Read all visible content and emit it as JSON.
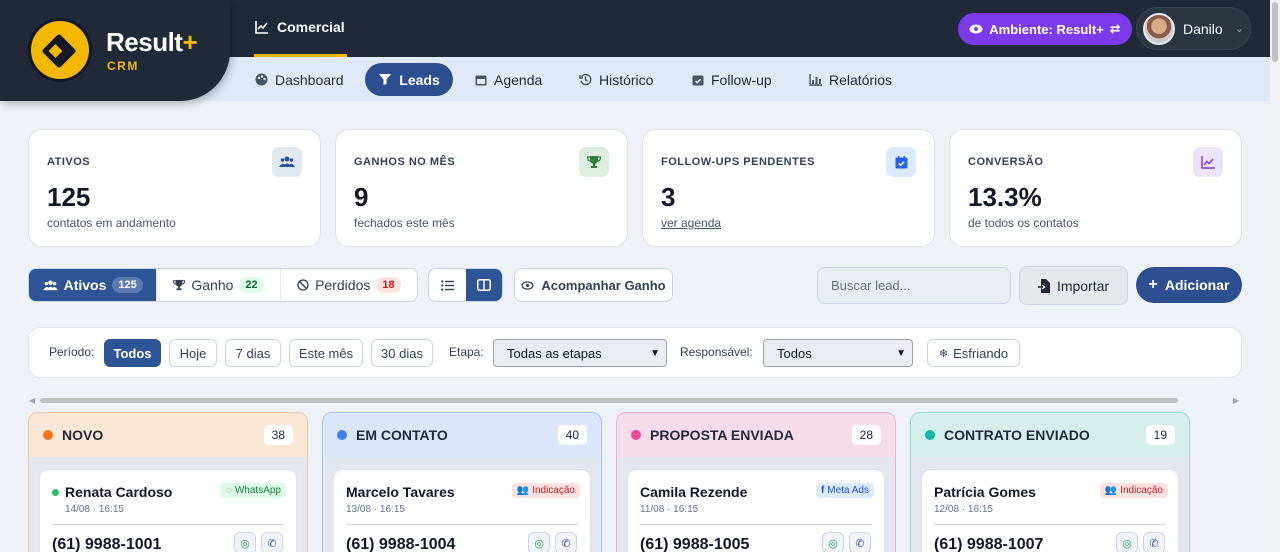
{
  "app": {
    "brand": "Result",
    "brand_plus": "+",
    "brand_sub": "CRM",
    "module": "Comercial"
  },
  "env": {
    "label": "Ambiente: Result+"
  },
  "user": {
    "name": "Danilo"
  },
  "nav": [
    {
      "label": "Dashboard",
      "icon": "palette-icon"
    },
    {
      "label": "Leads",
      "icon": "funnel-icon",
      "active": true
    },
    {
      "label": "Agenda",
      "icon": "calendar-icon"
    },
    {
      "label": "Histórico",
      "icon": "history-icon"
    },
    {
      "label": "Follow-up",
      "icon": "calendar-check-icon"
    },
    {
      "label": "Relatórios",
      "icon": "bar-chart-icon"
    }
  ],
  "stats": [
    {
      "label": "ATIVOS",
      "value": "125",
      "sub": "contatos em andamento",
      "icon": "users-icon",
      "color": "#2d5596"
    },
    {
      "label": "GANHOS NO MÊS",
      "value": "9",
      "sub": "fechados este mês",
      "icon": "trophy-icon",
      "color": "#16a34a"
    },
    {
      "label": "FOLLOW-UPS PENDENTES",
      "value": "3",
      "sub": "ver agenda",
      "icon": "calendar-check-icon",
      "color": "#2563eb"
    },
    {
      "label": "CONVERSÃO",
      "value": "13.3%",
      "sub": "de todos os contatos",
      "icon": "chart-line-icon",
      "color": "#7c3aed"
    }
  ],
  "segments": [
    {
      "label": "Ativos",
      "count": "125"
    },
    {
      "label": "Ganho",
      "count": "22"
    },
    {
      "label": "Perdidos",
      "count": "18"
    }
  ],
  "actions": {
    "follow": "Acompanhar Ganho",
    "search_placeholder": "Buscar lead...",
    "import": "Importar",
    "add": "Adicionar"
  },
  "filters": {
    "period_label": "Período:",
    "periods": [
      "Todos",
      "Hoje",
      "7 dias",
      "Este mês",
      "30 dias"
    ],
    "stage_label": "Etapa:",
    "stage_value": "Todas as etapas",
    "owner_label": "Responsável:",
    "owner_value": "Todos",
    "cooling": "Esfriando"
  },
  "columns": [
    {
      "title": "NOVO",
      "count": "38",
      "color": "#f97316",
      "lead": {
        "name": "Renata Cardoso",
        "date": "14/08 · 16:15",
        "phone": "(61) 9988-1001",
        "source": "WhatsApp",
        "online": true
      }
    },
    {
      "title": "EM CONTATO",
      "count": "40",
      "color": "#3b82f6",
      "lead": {
        "name": "Marcelo Tavares",
        "date": "13/08 · 16:15",
        "phone": "(61) 9988-1004",
        "source": "Indicação"
      }
    },
    {
      "title": "PROPOSTA ENVIADA",
      "count": "28",
      "color": "#ec4899",
      "lead": {
        "name": "Camila Rezende",
        "date": "11/08 · 16:15",
        "phone": "(61) 9988-1005",
        "source": "Meta Ads"
      }
    },
    {
      "title": "CONTRATO ENVIADO",
      "count": "19",
      "color": "#14b8a6",
      "lead": {
        "name": "Patrícia Gomes",
        "date": "12/08 · 16:15",
        "phone": "(61) 9988-1007",
        "source": "Indicação"
      }
    }
  ]
}
